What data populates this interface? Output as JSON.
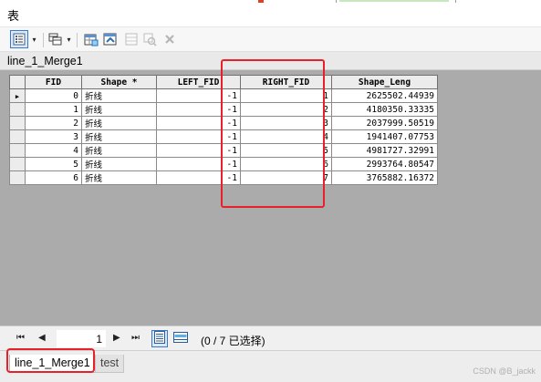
{
  "window": {
    "title": "表"
  },
  "toolbar": {
    "icons": [
      "table-options-icon",
      "dropdown-arrow-icon",
      "related-tables-icon",
      "select-by-attributes-icon",
      "switch-selection-icon",
      "clear-selection-icon",
      "zoom-to-selected-icon",
      "delete-selected-icon"
    ],
    "dropdown_glyph": "▾"
  },
  "table": {
    "name": "line_1_Merge1",
    "columns": [
      "FID",
      "Shape *",
      "LEFT_FID",
      "RIGHT_FID",
      "Shape_Leng"
    ],
    "current_row_marker": "▶",
    "rows": [
      {
        "fid": "0",
        "shape": "折线",
        "left_fid": "-1",
        "right_fid": "1",
        "shape_leng": "2625502.44939"
      },
      {
        "fid": "1",
        "shape": "折线",
        "left_fid": "-1",
        "right_fid": "2",
        "shape_leng": "4180350.33335"
      },
      {
        "fid": "2",
        "shape": "折线",
        "left_fid": "-1",
        "right_fid": "3",
        "shape_leng": "2037999.50519"
      },
      {
        "fid": "3",
        "shape": "折线",
        "left_fid": "-1",
        "right_fid": "4",
        "shape_leng": "1941407.07753"
      },
      {
        "fid": "4",
        "shape": "折线",
        "left_fid": "-1",
        "right_fid": "5",
        "shape_leng": "4981727.32991"
      },
      {
        "fid": "5",
        "shape": "折线",
        "left_fid": "-1",
        "right_fid": "6",
        "shape_leng": "2993764.80547"
      },
      {
        "fid": "6",
        "shape": "折线",
        "left_fid": "-1",
        "right_fid": "7",
        "shape_leng": "3765882.16372"
      }
    ]
  },
  "navigation": {
    "first": "⏮",
    "prev": "◀",
    "current_record": "1",
    "next": "▶",
    "last": "⏭",
    "selection_info": "(0 / 7 已选择)"
  },
  "tabs": [
    {
      "label": "line_1_Merge1",
      "active": true
    },
    {
      "label": "test",
      "active": false
    }
  ],
  "watermark": "CSDN @B_jackk",
  "colors": {
    "highlight": "#e8202a",
    "grid_background": "#ababab",
    "pressed": "#dbe8f7"
  }
}
